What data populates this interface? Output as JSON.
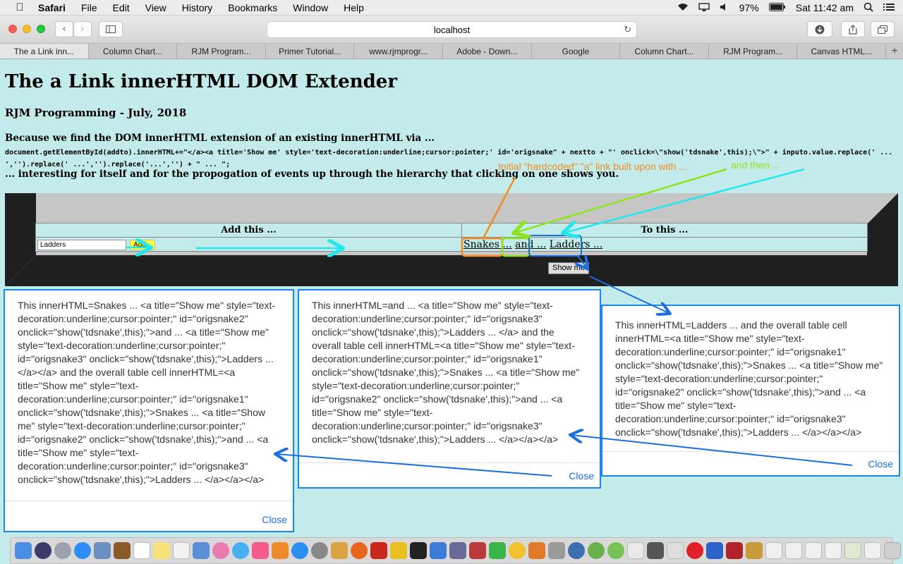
{
  "menubar": {
    "app": "Safari",
    "items": [
      "File",
      "Edit",
      "View",
      "History",
      "Bookmarks",
      "Window",
      "Help"
    ],
    "battery": "97%",
    "clock": "Sat 11:42 am"
  },
  "toolbar": {
    "url": "localhost"
  },
  "tabs": [
    "The a Link inn...",
    "Column Chart...",
    "RJM Program...",
    "Primer Tutorial...",
    "www.rjmprogr...",
    "Adobe - Down...",
    "Google",
    "Column Chart...",
    "RJM Program...",
    "Canvas HTML..."
  ],
  "page": {
    "title": "The a Link innerHTML DOM Extender",
    "subtitle": "RJM Programming - July, 2018",
    "intro": "Because we find the DOM innerHTML extension of an existing innerHTML via ...",
    "code": "document.getElementById(addto).innerHTML+=\"</a><a title='Show me' style='text-decoration:underline;cursor:pointer;' id='origsnake\" + nextto + \"' onclick=\\\"show('tdsnake',this);\\\">\" + inputo.value.replace(' ... ','').replace(' ...','').replace('...','') + \" ... \";",
    "outro": "... interesting for itself and for the propogation of events up through the hierarchy that clicking on one shows you.",
    "table": {
      "col1": "Add this ...",
      "col2": "To this ...",
      "input_value": "Ladders",
      "add_label": "Add...",
      "links": [
        "Snakes ...",
        "and ...",
        "Ladders ..."
      ]
    },
    "showme_label": "Show me"
  },
  "annotations": {
    "note1": "Initial \"hardcoded\" \"a\" link built upon with ...",
    "note2": "and then ...",
    "colors": {
      "orange": "#f28c1e",
      "green": "#8de61a",
      "cyan": "#22e8ee",
      "blue": "#1c6fe0"
    }
  },
  "popups": [
    {
      "text": "This innerHTML=Snakes ... <a title=\"Show me\" style=\"text-decoration:underline;cursor:pointer;\" id=\"origsnake2\" onclick=\"show('tdsnake',this);\">and ... <a title=\"Show me\" style=\"text-decoration:underline;cursor:pointer;\" id=\"origsnake3\" onclick=\"show('tdsnake',this);\">Ladders ... </a></a> and the overall table cell innerHTML=<a title=\"Show me\" style=\"text-decoration:underline;cursor:pointer;\" id=\"origsnake1\" onclick=\"show('tdsnake',this);\">Snakes ... <a title=\"Show me\" style=\"text-decoration:underline;cursor:pointer;\" id=\"origsnake2\" onclick=\"show('tdsnake',this);\">and ... <a title=\"Show me\" style=\"text-decoration:underline;cursor:pointer;\" id=\"origsnake3\" onclick=\"show('tdsnake',this);\">Ladders ... </a></a></a>",
      "close": "Close"
    },
    {
      "text": "This innerHTML=and ... <a title=\"Show me\" style=\"text-decoration:underline;cursor:pointer;\" id=\"origsnake3\" onclick=\"show('tdsnake',this);\">Ladders ... </a> and the overall table cell innerHTML=<a title=\"Show me\" style=\"text-decoration:underline;cursor:pointer;\" id=\"origsnake1\" onclick=\"show('tdsnake',this);\">Snakes ... <a title=\"Show me\" style=\"text-decoration:underline;cursor:pointer;\" id=\"origsnake2\" onclick=\"show('tdsnake',this);\">and ... <a title=\"Show me\" style=\"text-decoration:underline;cursor:pointer;\" id=\"origsnake3\" onclick=\"show('tdsnake',this);\">Ladders ... </a></a></a>",
      "close": "Close"
    },
    {
      "text": "This innerHTML=Ladders ...  and the overall table cell innerHTML=<a title=\"Show me\" style=\"text-decoration:underline;cursor:pointer;\" id=\"origsnake1\" onclick=\"show('tdsnake',this);\">Snakes ... <a title=\"Show me\" style=\"text-decoration:underline;cursor:pointer;\" id=\"origsnake2\" onclick=\"show('tdsnake',this);\">and ... <a title=\"Show me\" style=\"text-decoration:underline;cursor:pointer;\" id=\"origsnake3\" onclick=\"show('tdsnake',this);\">Ladders ... </a></a></a>",
      "close": "Close"
    }
  ]
}
